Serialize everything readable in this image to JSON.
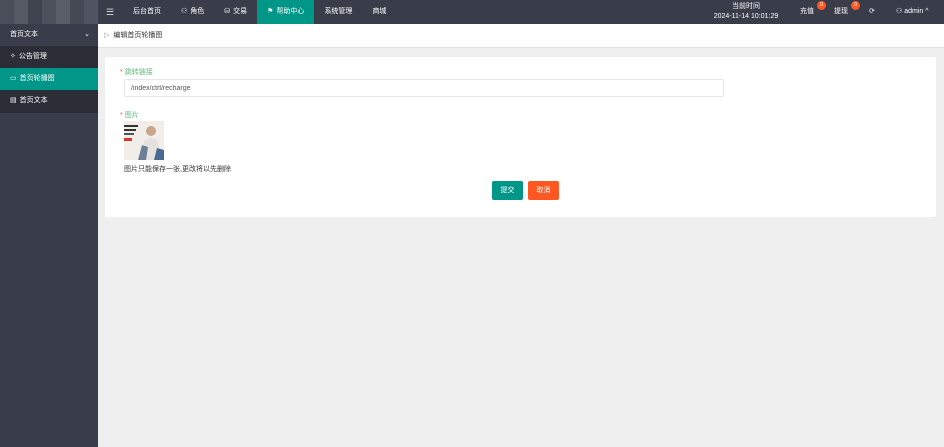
{
  "topbar": {
    "menu_icon": "menu-icon",
    "nav": [
      {
        "label": "后台首页",
        "icon": ""
      },
      {
        "label": "角色",
        "icon": "user-icon"
      },
      {
        "label": "交易",
        "icon": "coins-icon"
      },
      {
        "label": "帮助中心",
        "icon": "flag-icon",
        "active": true
      },
      {
        "label": "系统管理",
        "icon": ""
      },
      {
        "label": "商城",
        "icon": ""
      }
    ],
    "clock_label": "当前时间",
    "clock_value": "2024-11-14 10:01:29",
    "recharge_label": "充值",
    "recharge_badge": "0",
    "withdraw_label": "提现",
    "withdraw_badge": "0",
    "refresh_icon": "refresh-icon",
    "user_name": "admin",
    "user_chevron": "^"
  },
  "sidebar": {
    "group_label": "首页文本",
    "items": [
      {
        "label": "公告管理",
        "icon": "bullhorn-icon"
      },
      {
        "label": "首页轮播图",
        "icon": "image-icon",
        "active": true
      },
      {
        "label": "首页文本",
        "icon": "document-icon"
      }
    ]
  },
  "breadcrumb": {
    "label": "编辑首页轮播图"
  },
  "form": {
    "link_label": "跳转链接",
    "link_value": "/index/ctrl/recharge",
    "image_label": "图片",
    "image_note": "图片只能保存一张,更改将以先删除",
    "submit_label": "提交",
    "cancel_label": "取消"
  },
  "colors": {
    "topbar_bg": "#393d49",
    "accent": "#009688",
    "danger": "#ff5722",
    "label_green": "#5FB878"
  }
}
